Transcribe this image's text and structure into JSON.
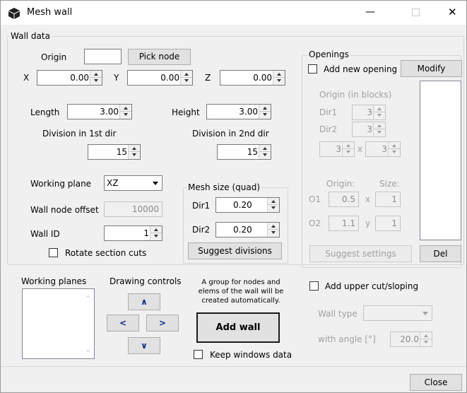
{
  "window": {
    "title": "Mesh wall",
    "minimize": "—",
    "close_glyph": "✕"
  },
  "wall_data": {
    "legend": "Wall data",
    "origin_label": "Origin",
    "origin_value": "",
    "pick_node": "Pick node",
    "x_label": "X",
    "x_value": "0.00",
    "y_label": "Y",
    "y_value": "0.00",
    "z_label": "Z",
    "z_value": "0.00",
    "length_label": "Length",
    "length_value": "3.00",
    "height_label": "Height",
    "height_value": "3.00",
    "div1_label": "Division in 1st dir",
    "div1_value": "15",
    "div2_label": "Division in 2nd dir",
    "div2_value": "15",
    "working_plane_label": "Working plane",
    "working_plane_value": "XZ",
    "node_offset_label": "Wall node offset",
    "node_offset_value": "10000",
    "wall_id_label": "Wall ID",
    "wall_id_value": "1",
    "rotate_label": "Rotate section cuts"
  },
  "mesh": {
    "legend": "Mesh size (quad)",
    "dir1_label": "Dir1",
    "dir1_value": "0.20",
    "dir2_label": "Dir2",
    "dir2_value": "0.20",
    "suggest": "Suggest divisions"
  },
  "openings": {
    "legend": "Openings",
    "add_label": "Add new opening",
    "modify": "Modify",
    "origin_blocks": "Origin (in blocks)",
    "dir1_label": "Dir1",
    "dir1_value": "3",
    "dir2_label": "Dir2",
    "dir2_value": "3",
    "size_a": "3",
    "x_sep": "x",
    "size_b": "3",
    "origin_hdr": "Origin:",
    "size_hdr": "Size:",
    "o1_label": "O1",
    "o1_origin": "0.5",
    "o1_x": "x",
    "o1_size": "1",
    "o2_label": "O2",
    "o2_origin": "1.1",
    "o2_y": "y",
    "o2_size": "1",
    "suggest_settings": "Suggest settings",
    "del": "Del"
  },
  "bottom": {
    "working_planes": "Working planes",
    "drawing_controls": "Drawing controls",
    "up": "∧",
    "left": "<",
    "right": ">",
    "down": "∨",
    "info": "A group for nodes and elems of the wall will be created automatically.",
    "add_wall": "Add wall",
    "keep_label": "Keep windows data",
    "upper_cut_label": "Add upper cut/sloping",
    "wall_type_label": "Wall type",
    "angle_label": "with angle [°]",
    "angle_value": "20.0",
    "close": "Close"
  }
}
